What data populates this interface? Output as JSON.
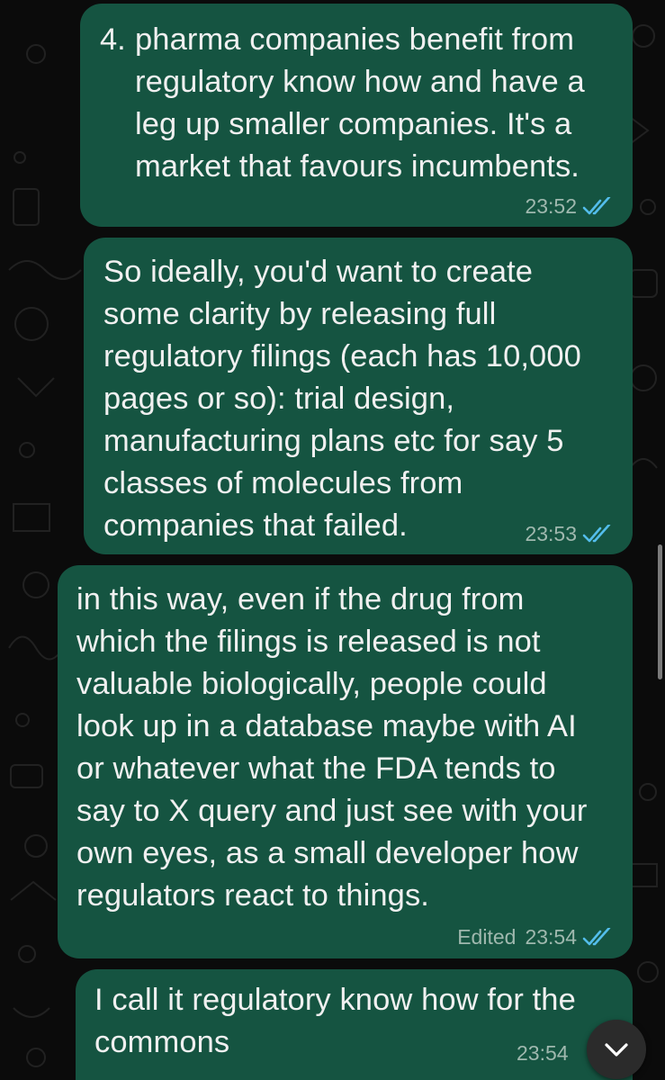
{
  "messages": [
    {
      "list_number": "4.",
      "lines": [
        "pharma companies benefit from",
        "regulatory know how and have a",
        "leg up smaller companies. It's a",
        "market that favours incumbents."
      ],
      "time": "23:52",
      "edited": "",
      "status": "read"
    },
    {
      "lines": [
        "So ideally, you'd want to create",
        "some clarity by releasing full",
        "regulatory filings (each has 10,000",
        "pages or so): trial design,",
        "manufacturing plans etc for say 5",
        "classes of molecules from",
        "companies that failed."
      ],
      "time": "23:53",
      "edited": "",
      "status": "read"
    },
    {
      "lines": [
        "in this way, even if the drug from",
        "which the filings is released is not",
        "valuable biologically, people could",
        "look up in a database maybe with AI",
        "or whatever what the FDA tends to",
        "say to X query and just see with your",
        "own eyes, as a small developer how",
        "regulators react to things."
      ],
      "time": "23:54",
      "edited": "Edited",
      "status": "read"
    },
    {
      "lines": [
        "I call it regulatory know how for the",
        "commons"
      ],
      "time": "23:54",
      "edited": "",
      "status": "read"
    }
  ],
  "colors": {
    "bubble": "#155441",
    "text": "#f0f0f0",
    "meta": "#9fb8ae",
    "read_ticks": "#53bdeb",
    "background": "#0b0b0b"
  },
  "icons": {
    "read_receipt": "double-check-icon",
    "scroll_down": "chevron-down-icon"
  }
}
